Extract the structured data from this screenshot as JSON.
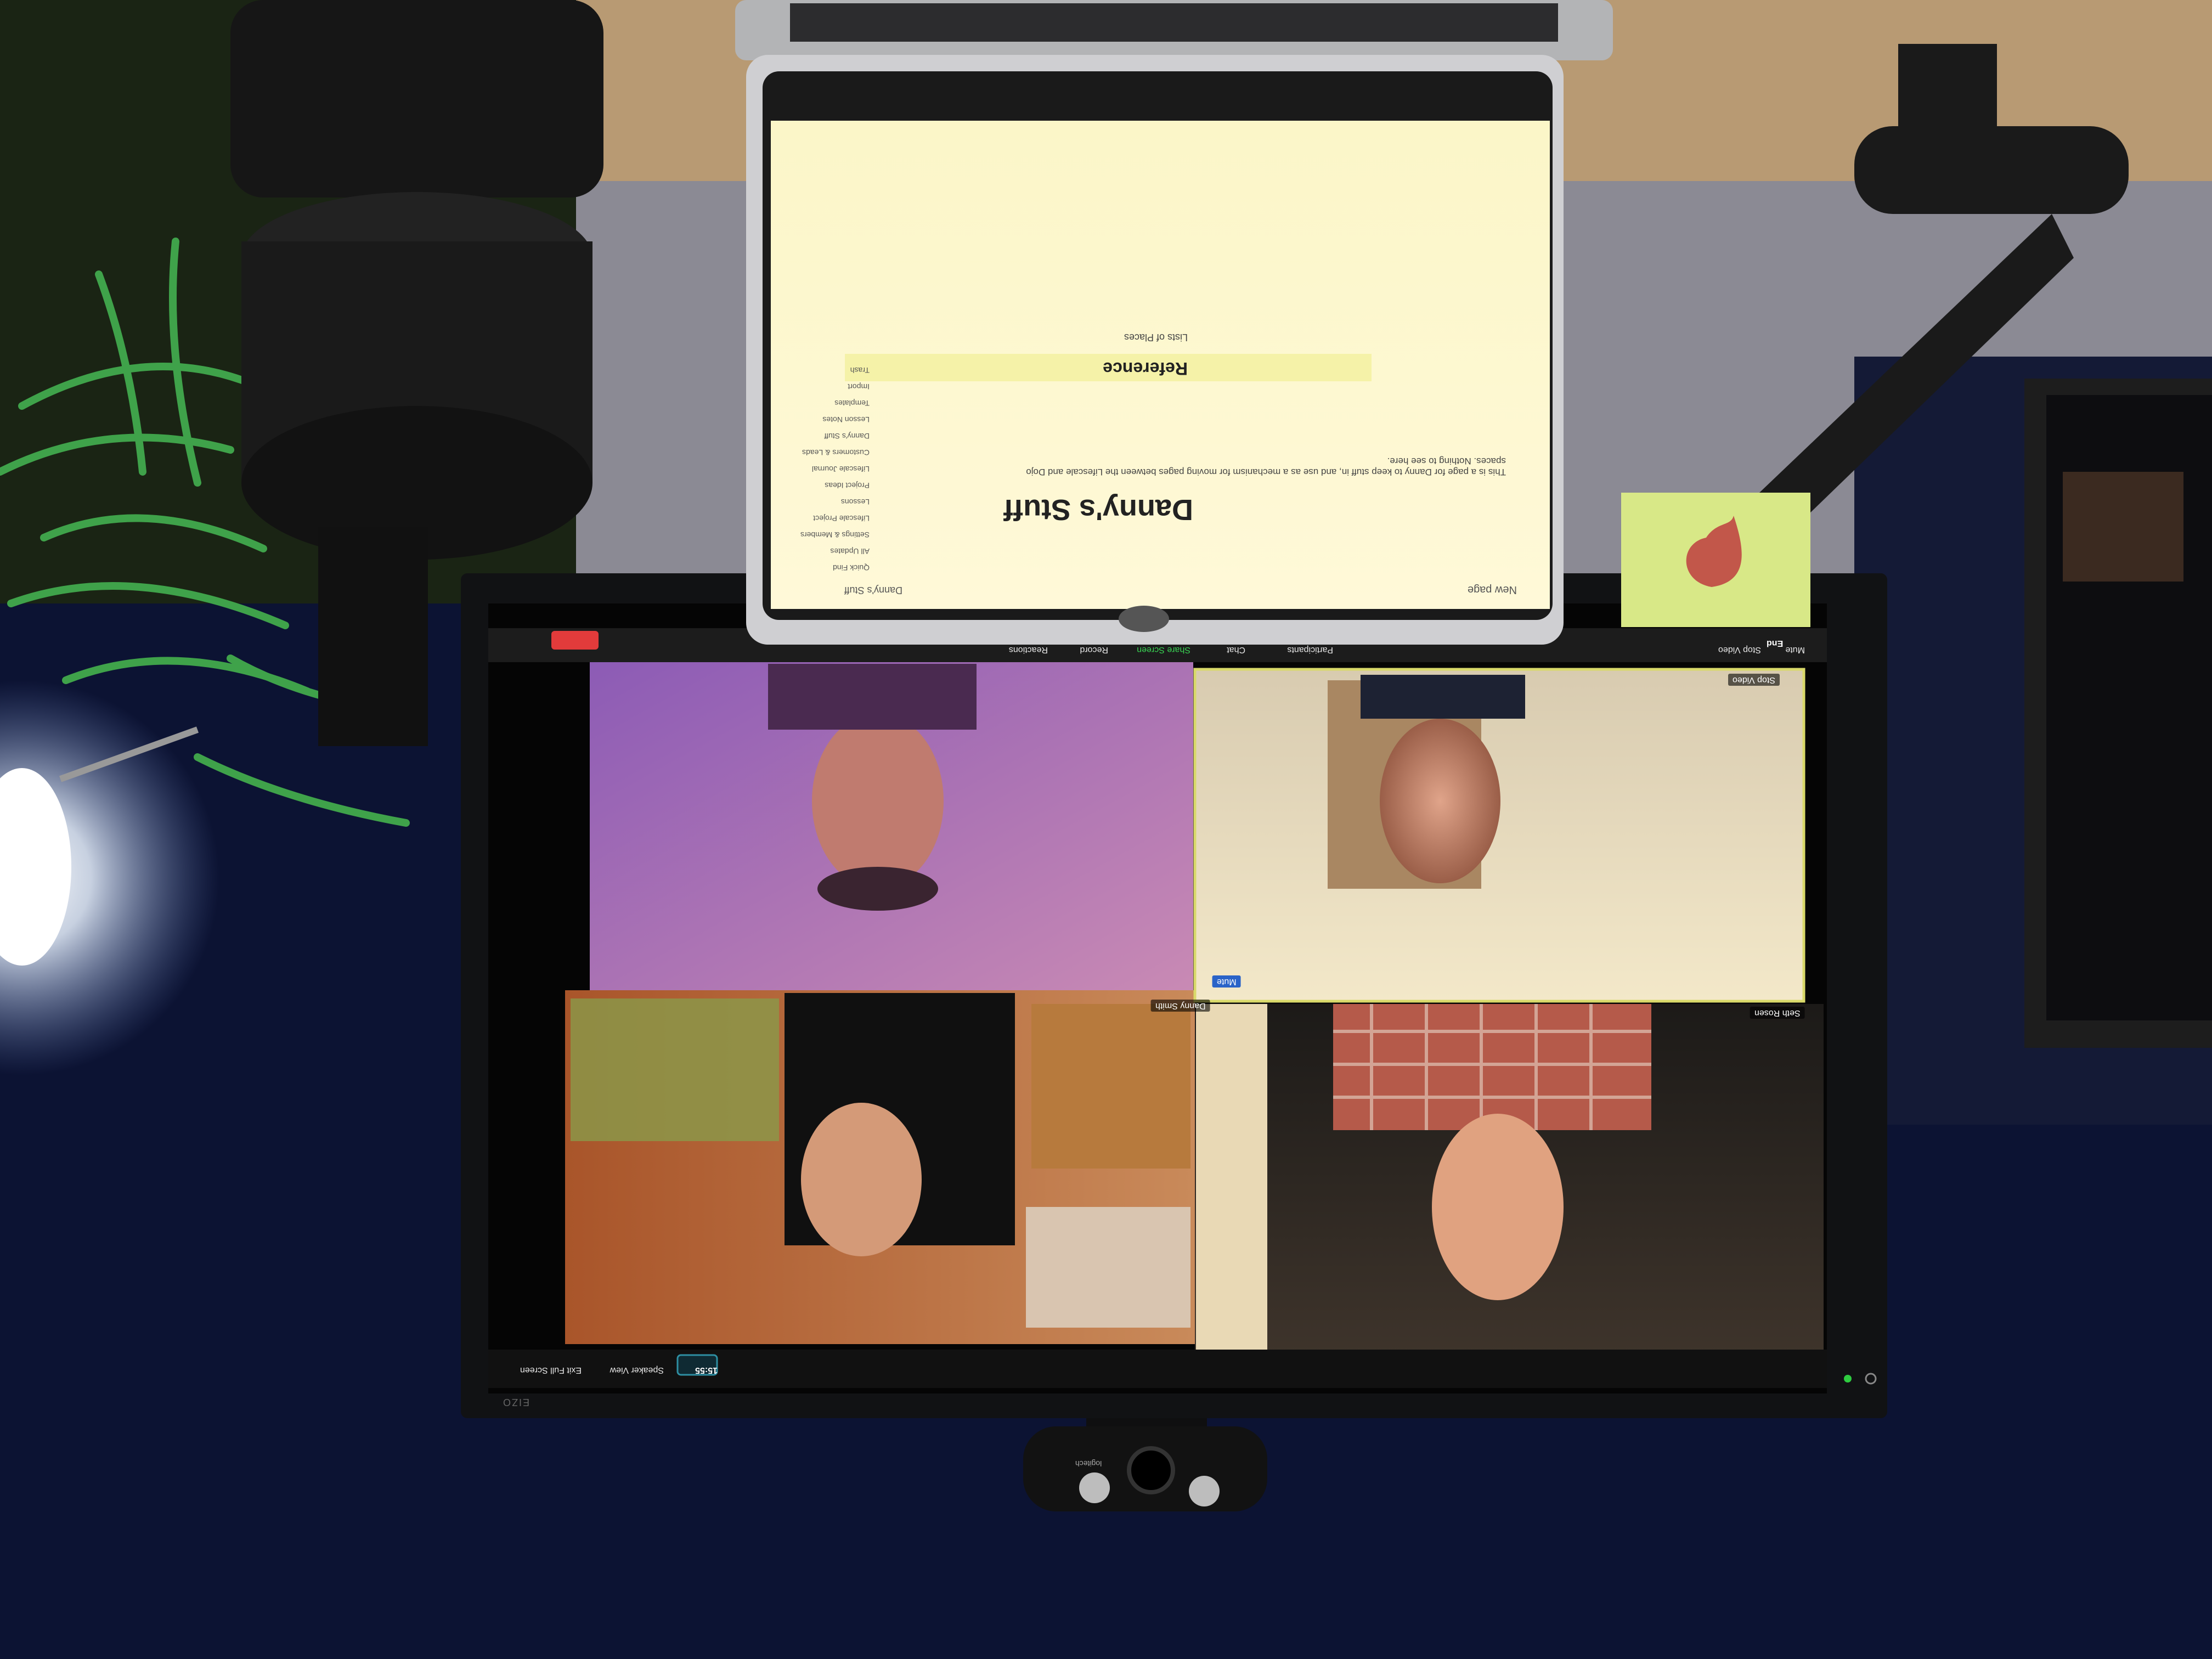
{
  "laptop": {
    "notion": {
      "breadcrumb": "Danny's Stuff",
      "new_page": "New page",
      "title": "Danny's Stuff",
      "description": "This is a page for Danny to keep stuff in, and use as a mechanism for moving pages between the Lifescale and Dojo",
      "description_line2": "spaces. Nothing to see here.",
      "section_heading": "Reference",
      "list_item": "Lists of Places",
      "sidebar": [
        "Quick Find",
        "All Updates",
        "Settings & Members",
        "Lifescale Project",
        "Lessons",
        "Project Ideas",
        "Lifescale Journal",
        "Customers & Leads",
        "Danny's Stuff",
        "Lesson Notes",
        "Templates",
        "Import",
        "Trash"
      ]
    }
  },
  "zoom": {
    "participants": [
      {
        "name": "Danny Smith"
      },
      {
        "name": "Seth Rosen"
      }
    ],
    "top_bar": {
      "end": "End",
      "mute": "Mute",
      "stop_video": "Stop Video",
      "participants": "Participants",
      "chat": "Chat",
      "share_screen": "Share Screen",
      "record": "Record",
      "reactions": "Reactions"
    },
    "bottom_bar": {
      "meeting_time": "15:55",
      "speaker_view": "Speaker View",
      "exit_full_screen": "Exit Full Screen"
    },
    "tile_status": "Mute",
    "active_speaker_label": "Stop Video"
  },
  "monitor": {
    "brand": "EIZO"
  },
  "webcam": {
    "brand": "logitech"
  },
  "colors": {
    "wall": "#3a3f4e",
    "desk_navy": "#0c1333",
    "tile_purple": "#b77ab3",
    "tile_beige": "#e6d8b8",
    "tile_warm": "#b86a3a",
    "tile_dark": "#2a2420",
    "zoom_end_red": "#e23b3b",
    "sticky_note": "#d8e887",
    "heart_red": "#c2574a",
    "lamp_glow": "#f0f6ff"
  }
}
